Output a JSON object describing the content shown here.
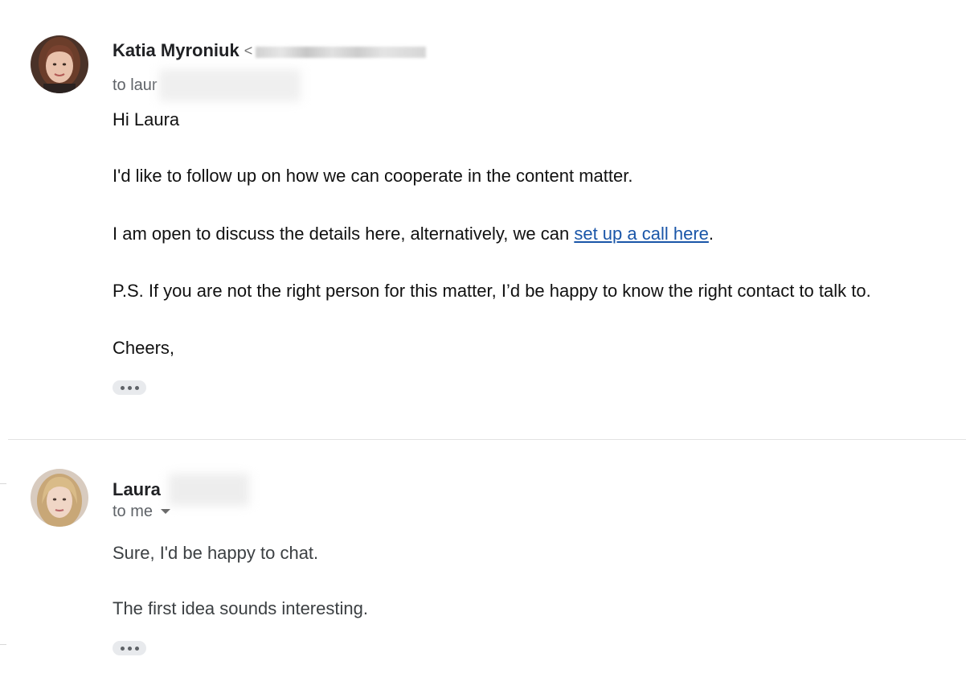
{
  "messages": [
    {
      "sender_name": "Katia Myroniuk",
      "sender_email_open": "<",
      "to_prefix": "to laur",
      "body": {
        "greeting": "Hi Laura",
        "p1": "I'd like to follow up on how we can cooperate in the content matter.",
        "p2_before": "I am open to discuss the details here, alternatively, we can ",
        "p2_link": "set up a call here",
        "p2_after": ".",
        "p3": "P.S. If you are not the right person for this matter, I’d be happy to know the right contact to talk to.",
        "signoff": "Cheers,"
      }
    },
    {
      "sender_name": "Laura",
      "to_prefix": "to me",
      "body": {
        "p1": "Sure, I'd be happy to chat.",
        "p2": "The first idea sounds interesting."
      }
    }
  ],
  "colors": {
    "link": "#1a56a8",
    "divider": "#e3e3e3",
    "secondary_text": "#5f6368"
  },
  "icons": {
    "expand_trimmed": "ellipsis-icon",
    "details_caret": "caret-down-icon"
  }
}
